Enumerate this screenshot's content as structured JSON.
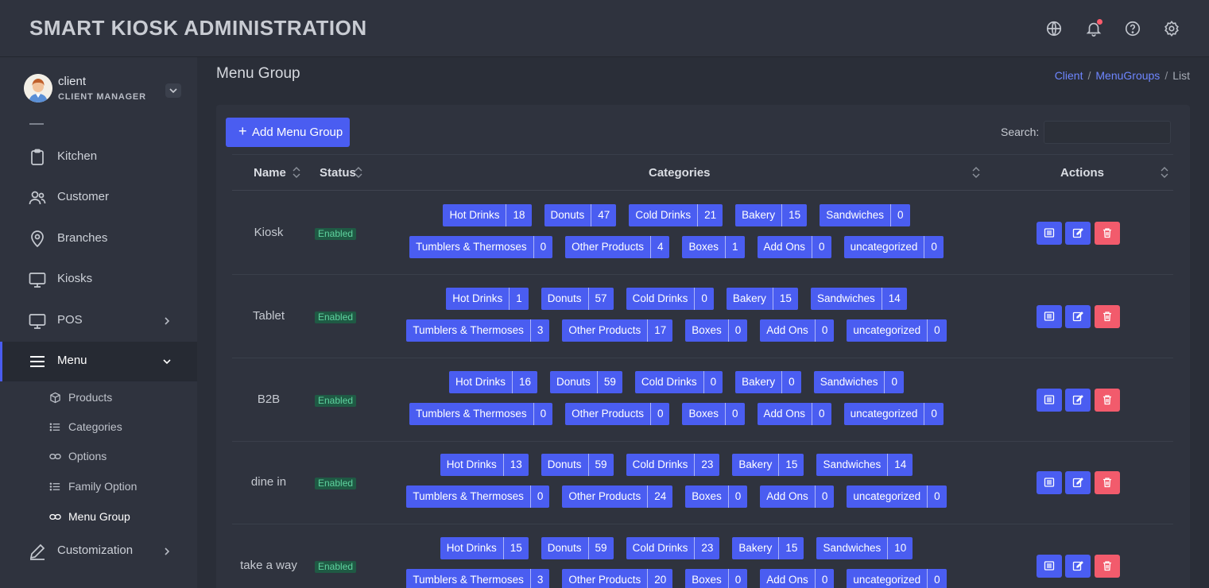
{
  "app": {
    "title": "SMART KIOSK ADMINISTRATION"
  },
  "topbar": {
    "icons": [
      "globe-icon",
      "bell-icon",
      "help-icon",
      "settings-icon"
    ]
  },
  "user": {
    "name": "client",
    "role": "CLIENT MANAGER"
  },
  "sidebar": {
    "items": [
      {
        "label": "Kitchen",
        "icon": "clipboard-icon"
      },
      {
        "label": "Customer",
        "icon": "users-icon"
      },
      {
        "label": "Branches",
        "icon": "map-pin-icon"
      },
      {
        "label": "Kiosks",
        "icon": "monitor-icon"
      },
      {
        "label": "POS",
        "icon": "monitor-icon"
      },
      {
        "label": "Menu",
        "icon": "menu-icon"
      },
      {
        "label": "Customization",
        "icon": "pen-icon"
      }
    ],
    "submenu": [
      {
        "label": "Products",
        "icon": "box-icon"
      },
      {
        "label": "Categories",
        "icon": "list-icon"
      },
      {
        "label": "Options",
        "icon": "link-icon"
      },
      {
        "label": "Family Option",
        "icon": "list-icon"
      },
      {
        "label": "Menu Group",
        "icon": "link-icon"
      }
    ]
  },
  "page": {
    "title": "Menu Group",
    "breadcrumb": [
      "Client",
      "MenuGroups",
      "List"
    ]
  },
  "toolbar": {
    "add_label": "Add Menu Group",
    "search_label": "Search:",
    "search_value": ""
  },
  "table": {
    "headers": [
      "Name",
      "Status",
      "Categories",
      "Actions"
    ],
    "rows": [
      {
        "name": "Kiosk",
        "status": "Enabled",
        "line1": [
          [
            "Hot Drinks",
            "18"
          ],
          [
            "Donuts",
            "47"
          ],
          [
            "Cold Drinks",
            "21"
          ],
          [
            "Bakery",
            "15"
          ],
          [
            "Sandwiches",
            "0"
          ]
        ],
        "line2": [
          [
            "Tumblers & Thermoses",
            "0"
          ],
          [
            "Other Products",
            "4"
          ],
          [
            "Boxes",
            "1"
          ],
          [
            "Add Ons",
            "0"
          ],
          [
            "uncategorized",
            "0"
          ]
        ]
      },
      {
        "name": "Tablet",
        "status": "Enabled",
        "line1": [
          [
            "Hot Drinks",
            "1"
          ],
          [
            "Donuts",
            "57"
          ],
          [
            "Cold Drinks",
            "0"
          ],
          [
            "Bakery",
            "15"
          ],
          [
            "Sandwiches",
            "14"
          ]
        ],
        "line2": [
          [
            "Tumblers & Thermoses",
            "3"
          ],
          [
            "Other Products",
            "17"
          ],
          [
            "Boxes",
            "0"
          ],
          [
            "Add Ons",
            "0"
          ],
          [
            "uncategorized",
            "0"
          ]
        ]
      },
      {
        "name": "B2B",
        "status": "Enabled",
        "line1": [
          [
            "Hot Drinks",
            "16"
          ],
          [
            "Donuts",
            "59"
          ],
          [
            "Cold Drinks",
            "0"
          ],
          [
            "Bakery",
            "0"
          ],
          [
            "Sandwiches",
            "0"
          ]
        ],
        "line2": [
          [
            "Tumblers & Thermoses",
            "0"
          ],
          [
            "Other Products",
            "0"
          ],
          [
            "Boxes",
            "0"
          ],
          [
            "Add Ons",
            "0"
          ],
          [
            "uncategorized",
            "0"
          ]
        ]
      },
      {
        "name": "dine in",
        "status": "Enabled",
        "line1": [
          [
            "Hot Drinks",
            "13"
          ],
          [
            "Donuts",
            "59"
          ],
          [
            "Cold Drinks",
            "23"
          ],
          [
            "Bakery",
            "15"
          ],
          [
            "Sandwiches",
            "14"
          ]
        ],
        "line2": [
          [
            "Tumblers & Thermoses",
            "0"
          ],
          [
            "Other Products",
            "24"
          ],
          [
            "Boxes",
            "0"
          ],
          [
            "Add Ons",
            "0"
          ],
          [
            "uncategorized",
            "0"
          ]
        ]
      },
      {
        "name": "take a way",
        "status": "Enabled",
        "line1": [
          [
            "Hot Drinks",
            "15"
          ],
          [
            "Donuts",
            "59"
          ],
          [
            "Cold Drinks",
            "23"
          ],
          [
            "Bakery",
            "15"
          ],
          [
            "Sandwiches",
            "10"
          ]
        ],
        "line2": [
          [
            "Tumblers & Thermoses",
            "3"
          ],
          [
            "Other Products",
            "20"
          ],
          [
            "Boxes",
            "0"
          ],
          [
            "Add Ons",
            "0"
          ],
          [
            "uncategorized",
            "0"
          ]
        ]
      }
    ]
  },
  "colors": {
    "accent": "#4a5df1",
    "danger": "#f25b6c",
    "success": "#5fd39f",
    "link": "#6e86ff"
  }
}
